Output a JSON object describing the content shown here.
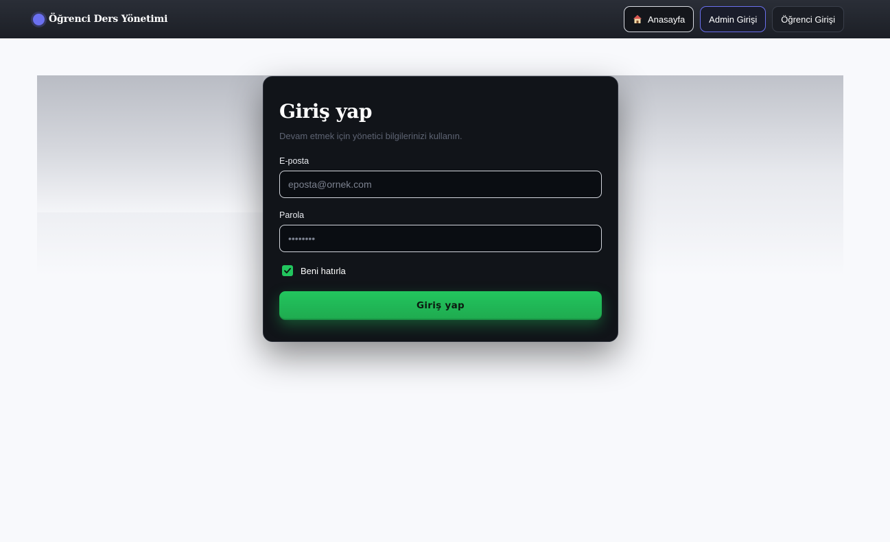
{
  "navbar": {
    "brand_title": "Öğrenci Ders Yönetimi",
    "buttons": [
      {
        "label": "Anasayfa",
        "icon": "home-icon"
      },
      {
        "label": "Admin Girişi"
      },
      {
        "label": "Öğrenci Girişi"
      }
    ]
  },
  "login": {
    "title": "Giriş yap",
    "subtitle": "Devam etmek için yönetici bilgilerinizi kullanın.",
    "email_label": "E-posta",
    "email_placeholder": "eposta@ornek.com",
    "password_label": "Parola",
    "password_placeholder": "••••••••",
    "remember_label": "Beni hatırla",
    "remember_checked": true,
    "submit_label": "Giriş yap"
  },
  "colors": {
    "accent": "#6b70f0",
    "success": "#22c55e",
    "card_bg": "#111419",
    "navbar_bg": "#1c1f26"
  }
}
